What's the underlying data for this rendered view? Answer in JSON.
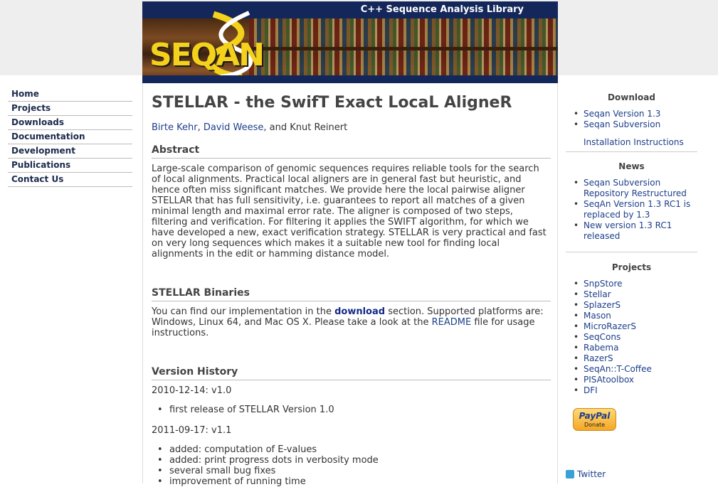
{
  "header": {
    "tagline": "C++ Sequence Analysis Library",
    "logo": "SEQAN"
  },
  "leftnav": {
    "items": [
      "Home",
      "Projects",
      "Downloads",
      "Documentation",
      "Development",
      "Publications",
      "Contact Us"
    ]
  },
  "main": {
    "title": "STELLAR - the SwifT Exact LocaL AligneR",
    "authors": {
      "a1": "Birte Kehr",
      "sep1": ", ",
      "a2": "David Weese",
      "tail": ", and Knut Reinert"
    },
    "abstract": {
      "heading": "Abstract",
      "text": "Large-scale comparison of genomic sequences requires reliable tools for the search of local alignments. Practical local aligners are in general fast but heuristic, and hence often miss significant matches. We provide here the local pairwise aligner STELLAR that has full sensitivity, i.e. guarantees to report all matches of a given minimal length and maximal error rate. The aligner is composed of two steps, filtering and verification. For filtering it applies the SWIFT algorithm, for which we have developed a new, exact verification strategy. STELLAR is very practical and fast on very long sequences which makes it a suitable new tool for finding local alignments in the edit or hamming distance model."
    },
    "binaries": {
      "heading": "STELLAR Binaries",
      "pre": "You can find our implementation in the ",
      "download_link": "download",
      "mid": " section. Supported platforms are: Windows, Linux 64, and Mac OS X. Please take a look at the ",
      "readme_link": "README",
      "post": " file for usage instructions."
    },
    "history": {
      "heading": "Version History",
      "v1_date": "2010-12-14: v1.0",
      "v1_items": [
        "first release of STELLAR Version 1.0"
      ],
      "v2_date": "2011-09-17: v1.1",
      "v2_items": [
        "added: computation of E-values",
        "added: print progress dots in verbosity mode",
        "several small bug fixes",
        "improvement of running time"
      ]
    }
  },
  "sidebar": {
    "download": {
      "title": "Download",
      "items": [
        "Seqan Version 1.3",
        "Seqan Subversion"
      ],
      "install": "Installation Instructions"
    },
    "news": {
      "title": "News",
      "items": [
        "Seqan Subversion Repository Restructured",
        "SeqAn Version 1.3 RC1 is replaced by 1.3",
        "New version 1.3 RC1 released"
      ]
    },
    "projects": {
      "title": "Projects",
      "items": [
        "SnpStore",
        "Stellar",
        "SplazerS",
        "Mason",
        "MicroRazerS",
        "SeqCons",
        "Rabema",
        "RazerS",
        "SeqAn::T-Coffee",
        "PISAtoolbox",
        "DFI"
      ]
    },
    "paypal": {
      "brand": "PayPal",
      "label": "Donate"
    },
    "twitter": "Twitter"
  }
}
